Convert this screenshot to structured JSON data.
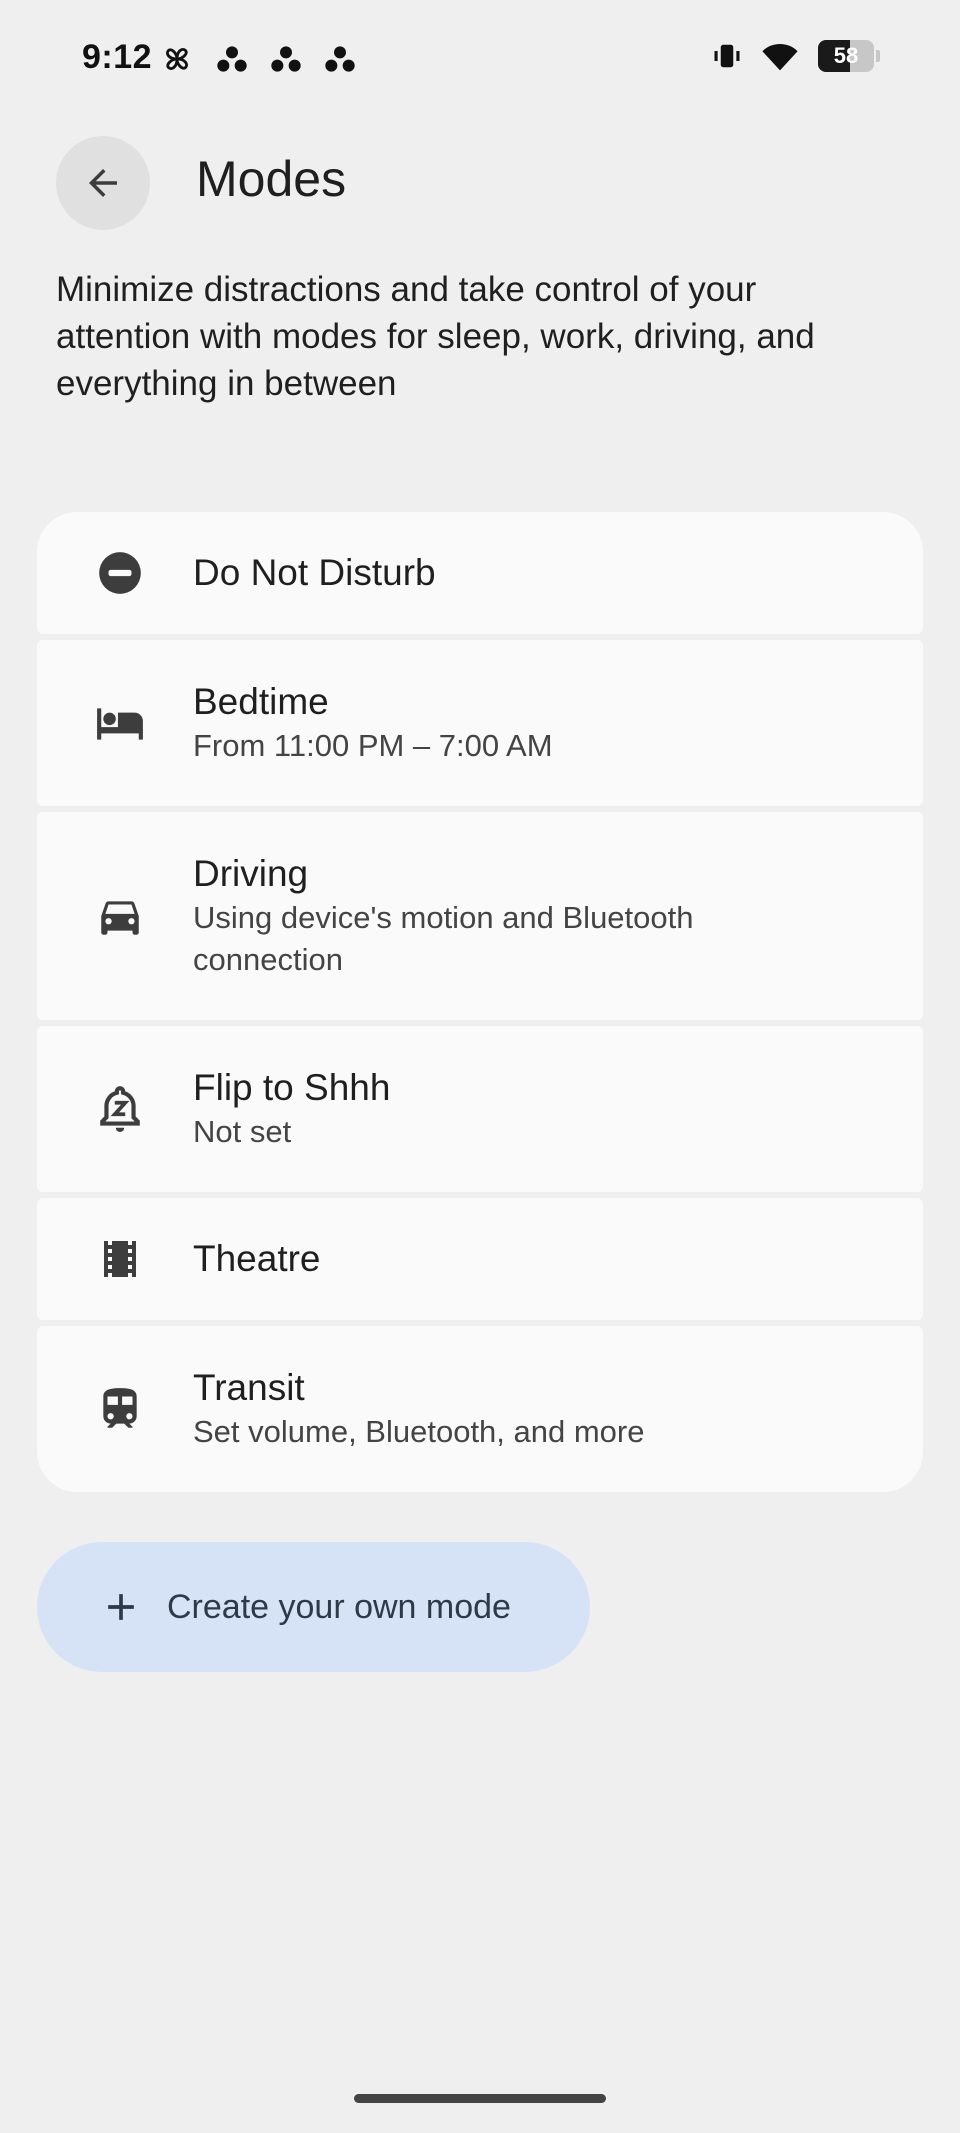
{
  "status": {
    "time": "9:12",
    "battery": "58",
    "battery_level_percent": 58
  },
  "header": {
    "title": "Modes",
    "back_icon": "arrow-back-icon"
  },
  "description": "Minimize distractions and take control of your attention with modes for sleep, work, driving, and everything in between",
  "modes": [
    {
      "title": "Do Not Disturb",
      "subtitle": "",
      "icon": "do-not-disturb-icon"
    },
    {
      "title": "Bedtime",
      "subtitle": "From 11:00 PM – 7:00 AM",
      "icon": "bed-icon"
    },
    {
      "title": "Driving",
      "subtitle": "Using device's motion and Bluetooth connection",
      "icon": "car-icon"
    },
    {
      "title": "Flip to Shhh",
      "subtitle": "Not set",
      "icon": "bell-z-icon"
    },
    {
      "title": "Theatre",
      "subtitle": "",
      "icon": "film-icon"
    },
    {
      "title": "Transit",
      "subtitle": "Set volume, Bluetooth, and more",
      "icon": "train-icon"
    }
  ],
  "create_button": {
    "label": "Create your own mode",
    "icon": "plus-icon"
  },
  "colors": {
    "background": "#efefef",
    "card": "#fafafa",
    "create_button": "#d6e3f6"
  }
}
